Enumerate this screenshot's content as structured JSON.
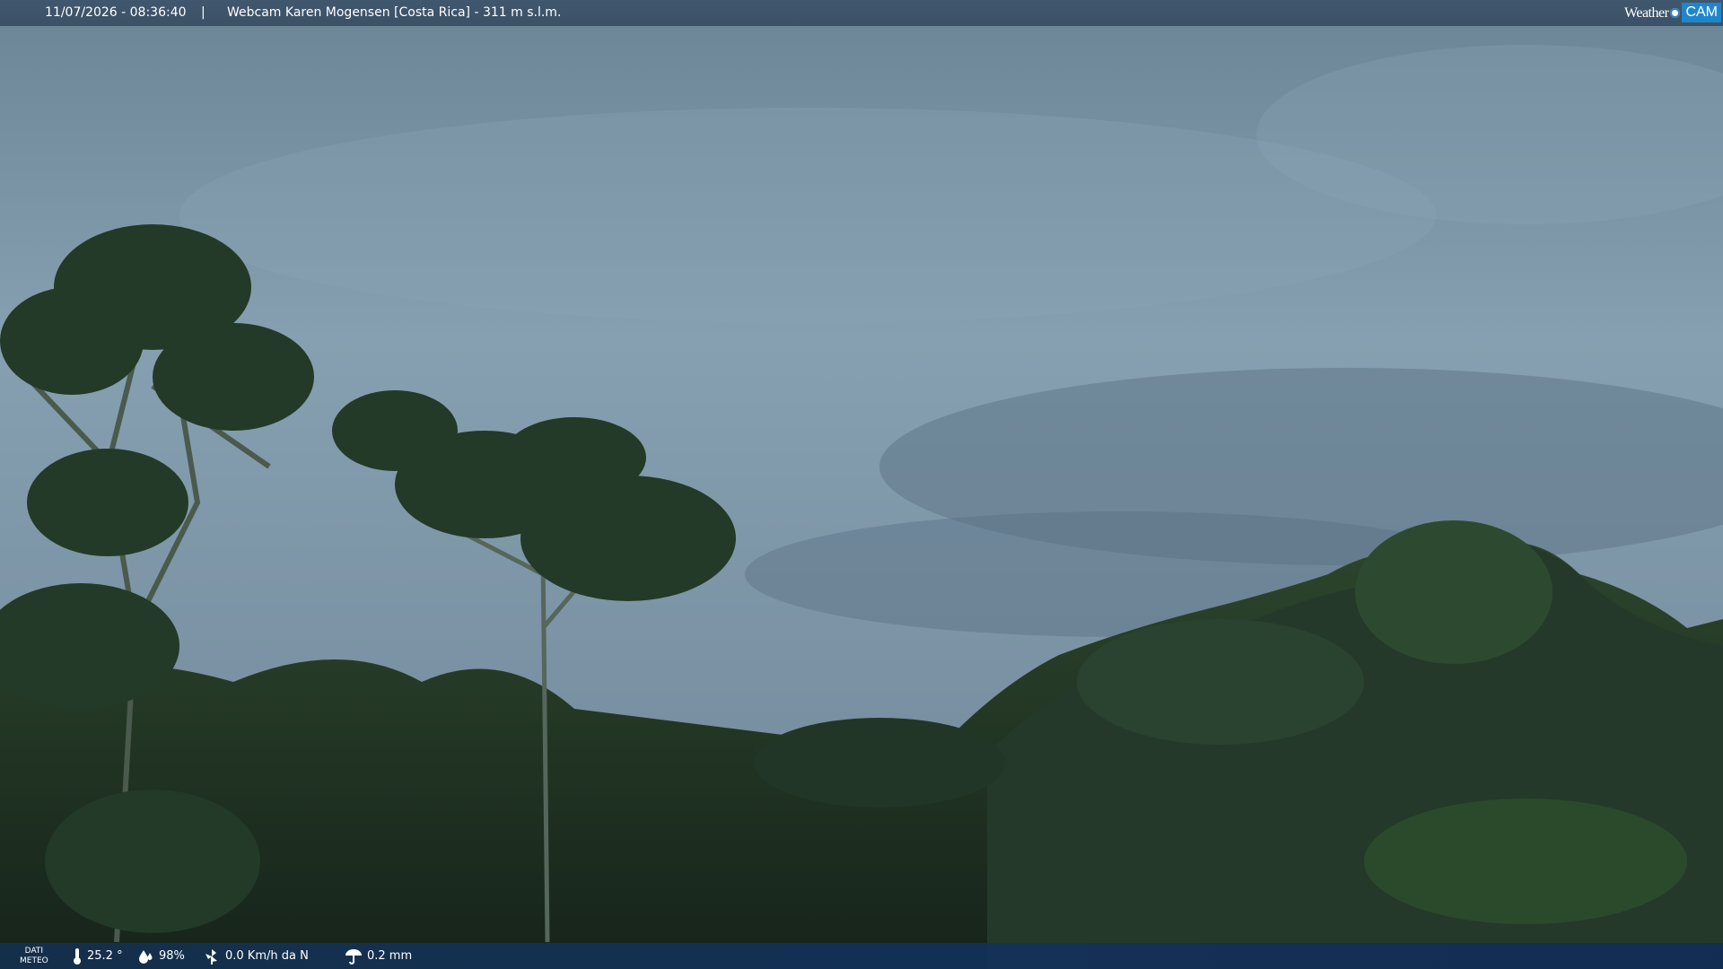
{
  "header": {
    "timestamp": "11/07/2026 - 08:36:40",
    "separator": "|",
    "title": "Webcam Karen Mogensen [Costa Rica]  - 311 m s.l.m."
  },
  "logo": {
    "word": "Weather",
    "cam": "CAM"
  },
  "weather": {
    "label_line1": "DATI",
    "label_line2": "METEO",
    "temperature": "25.2 °",
    "humidity": "98%",
    "wind": "0.0 Km/h da N",
    "rain": "0.2 mm",
    "icons": [
      "thermometer-icon",
      "humidity-icon",
      "wind-icon",
      "rain-icon"
    ]
  },
  "colors": {
    "sky": "#7c94a6",
    "forest": "#1d2e1e",
    "bar": "#3b5166",
    "logo_blue": "#1f86cc"
  }
}
